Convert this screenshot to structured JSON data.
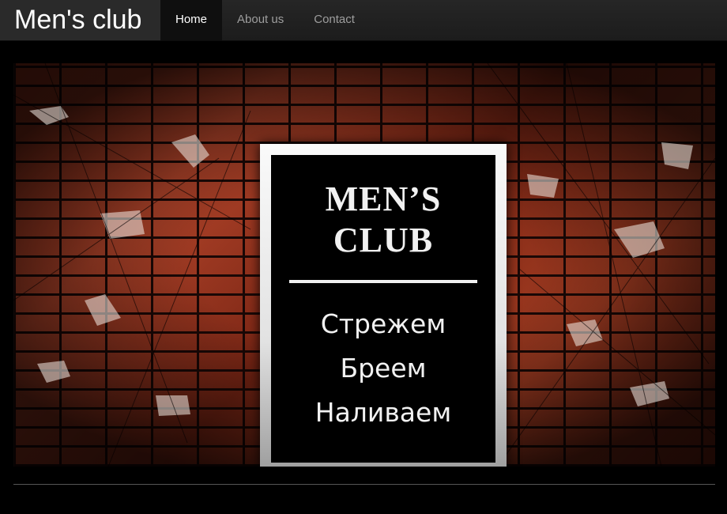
{
  "navbar": {
    "brand": "Men's club",
    "items": [
      {
        "label": "Home",
        "active": true
      },
      {
        "label": "About us",
        "active": false
      },
      {
        "label": "Contact",
        "active": false
      }
    ]
  },
  "hero": {
    "sign": {
      "title": "MEN’S CLUB",
      "lines": [
        "Стрежем",
        "Бреем",
        "Наливаем"
      ]
    }
  },
  "colors": {
    "navbar_bg": "#222222",
    "active_bg": "#0f0f0f",
    "nav_text": "#9d9d9d",
    "page_bg": "#000000",
    "brick": "#a53d22"
  }
}
